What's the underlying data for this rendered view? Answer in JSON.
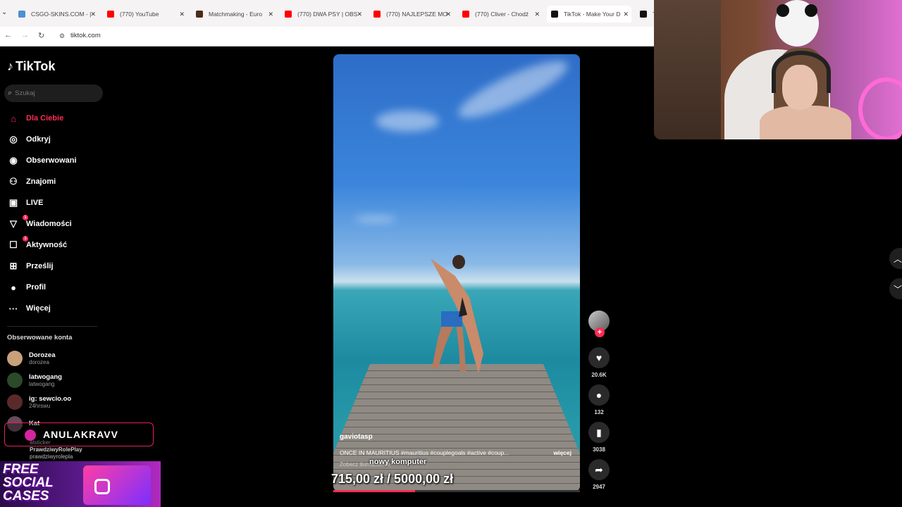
{
  "browser": {
    "tabs": [
      {
        "title": "CSGO-SKINS.COM - |",
        "color": "#4b8fd6",
        "active": false
      },
      {
        "title": "(770) YouTube",
        "color": "#ff0000",
        "active": false
      },
      {
        "title": "Matchmaking - Euro",
        "color": "#4a2a1a",
        "active": false
      },
      {
        "title": "(770) DWA PSY | OBS",
        "color": "#ff0000",
        "active": false
      },
      {
        "title": "(770) NAJLEPSZE MO",
        "color": "#ff0000",
        "active": false
      },
      {
        "title": "(770) Cliver - Chodź",
        "color": "#ff0000",
        "active": false
      },
      {
        "title": "TikTok - Make Your D",
        "color": "#111111",
        "active": true
      },
      {
        "title": "T",
        "color": "#111111",
        "active": false
      }
    ],
    "url": "tiktok.com"
  },
  "tiktok": {
    "logo": "TikTok",
    "search_placeholder": "Szukaj",
    "nav": [
      {
        "label": "Dla Ciebie",
        "icon": "home-icon",
        "glyph": "⌂",
        "active": true
      },
      {
        "label": "Odkryj",
        "icon": "compass-icon",
        "glyph": "◎",
        "active": false
      },
      {
        "label": "Obserwowani",
        "icon": "following-avatar-icon",
        "glyph": "◉",
        "active": false
      },
      {
        "label": "Znajomi",
        "icon": "friends-icon",
        "glyph": "⚇",
        "active": false
      },
      {
        "label": "LIVE",
        "icon": "live-icon",
        "glyph": "▣",
        "active": false
      },
      {
        "label": "Wiadomości",
        "icon": "messages-icon",
        "glyph": "▽",
        "active": false,
        "badge": "1"
      },
      {
        "label": "Aktywność",
        "icon": "activity-icon",
        "glyph": "☐",
        "active": false,
        "badge": "1"
      },
      {
        "label": "Prześlij",
        "icon": "upload-icon",
        "glyph": "⊞",
        "active": false
      },
      {
        "label": "Profil",
        "icon": "profile-avatar-icon",
        "glyph": "●",
        "active": false
      },
      {
        "label": "Więcej",
        "icon": "more-icon",
        "glyph": "···",
        "active": false
      }
    ],
    "following_title": "Obserwowane konta",
    "following": [
      {
        "name": "Dorozea",
        "handle": "dorozea",
        "color": "#c8a07a"
      },
      {
        "name": "latwogang",
        "handle": "latwogang",
        "color": "#2a4a2a"
      },
      {
        "name": "ig: sewcio.oo",
        "handle": "24hrswu",
        "color": "#5a2a2a"
      },
      {
        "name": "Kat",
        "handle": "",
        "color": "#6a4a5a"
      }
    ],
    "video": {
      "username": "gaviotasp",
      "description": "ONCE IN MAURITIUS #mauritius #couplegoals #active #coup...",
      "more": "więcej",
      "see_translation": "Zobacz tłumaczenie",
      "progress": 0.33
    },
    "actions": {
      "likes": "20.6K",
      "comments": "132",
      "saves": "3038",
      "shares": "2947"
    }
  },
  "stream_overlay": {
    "streamer": "ANULAKRAVV",
    "sub1": "atsticker",
    "sub2": "PrawdziwyRolePlay",
    "sub3": "prawdziwyrolepla",
    "promo": [
      "FREE",
      "SOCIAL",
      "CASES"
    ],
    "caption_top": "nowy komputer",
    "caption_bottom": "715,00 zł / 5000,00 zł"
  }
}
